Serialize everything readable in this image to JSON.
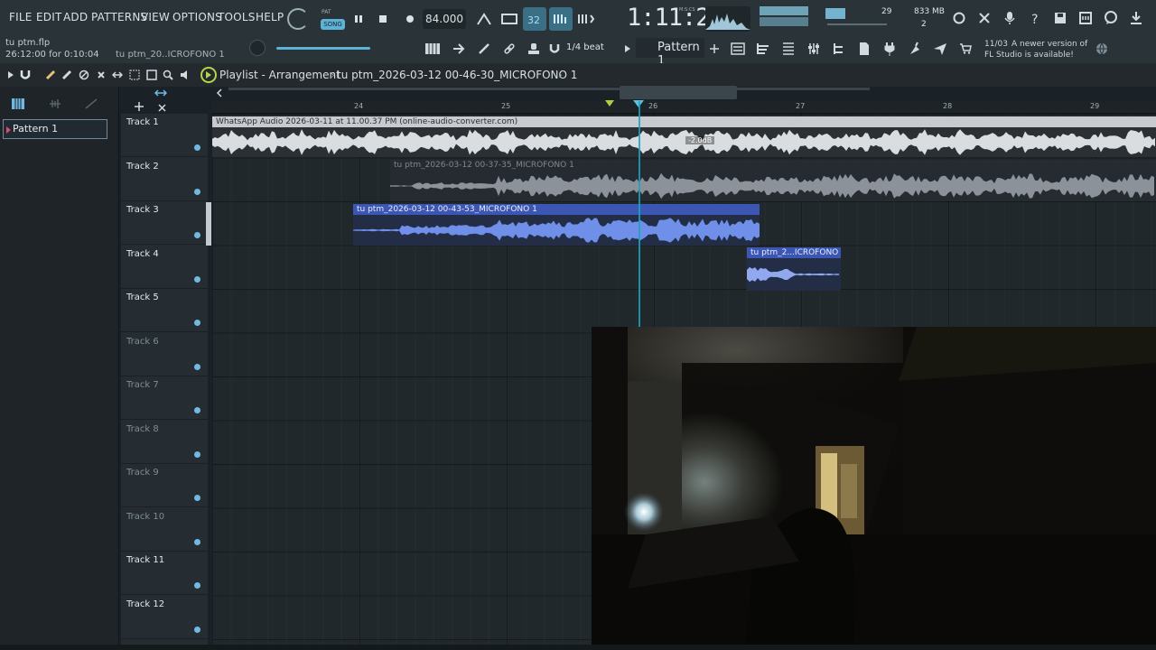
{
  "menu": {
    "file": "FILE",
    "edit": "EDIT",
    "add": "ADD",
    "patterns": "PATTERNS",
    "view": "VIEW",
    "options": "OPTIONS",
    "tools": "TOOLS",
    "help": "HELP"
  },
  "project": {
    "filename": "tu ptm.flp",
    "time": "26:12:00 for 0:10:04",
    "hint_clip": "tu ptm_20..ICROFONO 1"
  },
  "transport": {
    "mode_pat": "PAT",
    "mode_song": "SONG",
    "tempo": "84.000",
    "time_display": "1:11:29",
    "time_unit": "M:S:CS"
  },
  "monitor": {
    "cpu": "29",
    "ram": "833 MB",
    "poly": "2"
  },
  "snap": "1/4 beat",
  "pattern_selector": "Pattern 1",
  "update_notice": {
    "date": "11/03",
    "line1": "A newer version of",
    "line2": "FL Studio is available!"
  },
  "playlist": {
    "title": "Playlist - Arrangement",
    "path": "tu  ptm_2026-03-12 00-46-30_MICROFONO 1"
  },
  "pattern_list": [
    "Pattern 1"
  ],
  "ruler": [
    "24",
    "25",
    "26",
    "27",
    "28",
    "29"
  ],
  "tracks": [
    {
      "name": "Track 1",
      "active": true
    },
    {
      "name": "Track 2",
      "active": true
    },
    {
      "name": "Track 3",
      "active": true
    },
    {
      "name": "Track 4",
      "active": true
    },
    {
      "name": "Track 5",
      "active": true
    },
    {
      "name": "Track 6",
      "active": false
    },
    {
      "name": "Track 7",
      "active": false
    },
    {
      "name": "Track 8",
      "active": false
    },
    {
      "name": "Track 9",
      "active": false
    },
    {
      "name": "Track 10",
      "active": false
    },
    {
      "name": "Track 11",
      "active": true
    },
    {
      "name": "Track 12",
      "active": true
    }
  ],
  "clips": [
    {
      "title": "WhatsApp Audio 2026-03-11 at 11.00.37 PM (online-audio-converter.com)",
      "gain_label": "-2.0dB"
    },
    {
      "title": "tu  ptm_2026-03-12 00-37-35_MICROFONO 1"
    },
    {
      "title": "tu  ptm_2026-03-12 00-43-53_MICROFONO 1"
    },
    {
      "title": "tu  ptm_2...ICROFONO 1"
    }
  ],
  "colors": {
    "accent": "#1fa2b8",
    "clip_blue": "#6f8fe8",
    "clip_header_blue": "#3b57b3",
    "clip_grey": "#8b929a"
  }
}
